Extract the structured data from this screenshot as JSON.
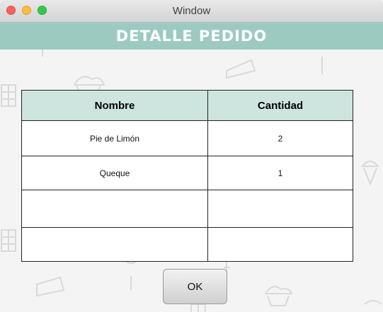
{
  "window": {
    "title": "Window"
  },
  "banner": {
    "title": "DETALLE PEDIDO"
  },
  "table": {
    "headers": [
      "Nombre",
      "Cantidad"
    ],
    "rows": [
      {
        "nombre": "Pie de Limón",
        "cantidad": "2"
      },
      {
        "nombre": "Queque",
        "cantidad": "1"
      },
      {
        "nombre": "",
        "cantidad": ""
      },
      {
        "nombre": "",
        "cantidad": ""
      }
    ]
  },
  "buttons": {
    "ok_label": "OK"
  },
  "colors": {
    "banner": "#9ccac1",
    "header_row": "#cde4df"
  }
}
